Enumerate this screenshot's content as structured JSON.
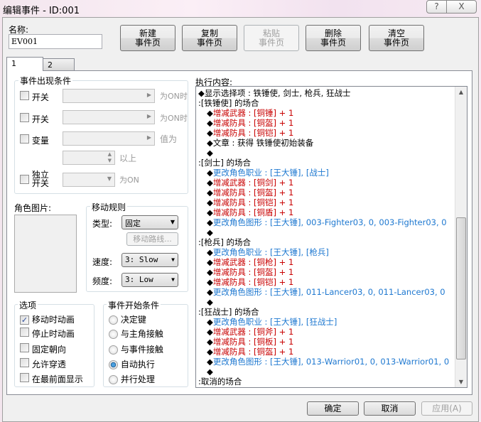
{
  "window": {
    "title": "编辑事件 - ID:001",
    "help": "?",
    "close": "X"
  },
  "name": {
    "label": "名称:",
    "value": "EV001"
  },
  "toolbar": [
    {
      "l1": "新建",
      "l2": "事件页",
      "disabled": false
    },
    {
      "l1": "复制",
      "l2": "事件页",
      "disabled": false
    },
    {
      "l1": "粘贴",
      "l2": "事件页",
      "disabled": true
    },
    {
      "l1": "删除",
      "l2": "事件页",
      "disabled": false
    },
    {
      "l1": "清空",
      "l2": "事件页",
      "disabled": false
    }
  ],
  "tabs": [
    "1",
    "2"
  ],
  "conditions": {
    "title": "事件出现条件",
    "switch1": "开关",
    "switch2": "开关",
    "variable": "变量",
    "self_l1": "独立",
    "self_l2": "开关",
    "on_when1": "为ON时",
    "on_when2": "为ON时",
    "value_is": "值为",
    "above": "以上",
    "is_on": "为ON"
  },
  "graphic": {
    "label": "角色图片:"
  },
  "movement": {
    "title": "移动规则",
    "type_label": "类型:",
    "type_value": "固定",
    "route": "移动路线...",
    "speed_label": "速度:",
    "speed_value": "3: Slow",
    "freq_label": "频度:",
    "freq_value": "3: Low"
  },
  "options": {
    "title": "选项",
    "items": [
      {
        "label": "移动时动画",
        "checked": true
      },
      {
        "label": "停止时动画",
        "checked": false
      },
      {
        "label": "固定朝向",
        "checked": false
      },
      {
        "label": "允许穿透",
        "checked": false
      },
      {
        "label": "在最前面显示",
        "checked": false
      }
    ]
  },
  "trigger": {
    "title": "事件开始条件",
    "items": [
      {
        "label": "决定键",
        "selected": false
      },
      {
        "label": "与主角接触",
        "selected": false
      },
      {
        "label": "与事件接触",
        "selected": false
      },
      {
        "label": "自动执行",
        "selected": true
      },
      {
        "label": "并行处理",
        "selected": false
      }
    ]
  },
  "contents": {
    "label": "执行内容:",
    "lines": [
      {
        "t": "◆显示选择项 : 铁锤使, 剑士, 枪兵, 狂战士",
        "c": "",
        "i": 0
      },
      {
        "t": ":[铁锤使] 的场合",
        "c": "",
        "i": 0
      },
      {
        "t": "增减武器 : [铜锤] + 1",
        "c": "red",
        "i": 1
      },
      {
        "t": "增减防具 : [铜盔] + 1",
        "c": "red",
        "i": 1
      },
      {
        "t": "增减防具 : [铜铠] + 1",
        "c": "red",
        "i": 1
      },
      {
        "t": "文章 : 获得    铁锤使初始装备",
        "c": "",
        "i": 1
      },
      {
        "t": "",
        "c": "",
        "i": 1
      },
      {
        "t": ":[剑士] 的场合",
        "c": "",
        "i": 0
      },
      {
        "t": "更改角色职业 : [王大锤], [战士]",
        "c": "blue",
        "i": 1
      },
      {
        "t": "增减武器 : [铜剑] + 1",
        "c": "red",
        "i": 1
      },
      {
        "t": "增减防具 : [铜盔] + 1",
        "c": "red",
        "i": 1
      },
      {
        "t": "增减防具 : [铜铠] + 1",
        "c": "red",
        "i": 1
      },
      {
        "t": "增减防具 : [铜盾] + 1",
        "c": "red",
        "i": 1
      },
      {
        "t": "更改角色图形 : [王大锤], 003-Fighter03, 0, 003-Fighter03, 0",
        "c": "blue",
        "i": 1
      },
      {
        "t": "",
        "c": "",
        "i": 1
      },
      {
        "t": ":[枪兵] 的场合",
        "c": "",
        "i": 0
      },
      {
        "t": "更改角色职业 : [王大锤], [枪兵]",
        "c": "blue",
        "i": 1
      },
      {
        "t": "增减武器 : [铜枪] + 1",
        "c": "red",
        "i": 1
      },
      {
        "t": "增减防具 : [铜盔] + 1",
        "c": "red",
        "i": 1
      },
      {
        "t": "增减防具 : [铜铠] + 1",
        "c": "red",
        "i": 1
      },
      {
        "t": "更改角色图形 : [王大锤], 011-Lancer03, 0, 011-Lancer03, 0",
        "c": "blue",
        "i": 1
      },
      {
        "t": "",
        "c": "",
        "i": 1
      },
      {
        "t": ":[狂战士] 的场合",
        "c": "",
        "i": 0
      },
      {
        "t": "更改角色职业 : [王大锤], [狂战士]",
        "c": "blue",
        "i": 1
      },
      {
        "t": "增减武器 : [铜斧] + 1",
        "c": "red",
        "i": 1
      },
      {
        "t": "增减防具 : [铜板] + 1",
        "c": "red",
        "i": 1
      },
      {
        "t": "增减防具 : [铜盔] + 1",
        "c": "red",
        "i": 1
      },
      {
        "t": "更改角色图形 : [王大锤], 013-Warrior01, 0, 013-Warrior01, 0",
        "c": "blue",
        "i": 1
      },
      {
        "t": "",
        "c": "",
        "i": 1
      },
      {
        "t": ":取消的场合",
        "c": "",
        "i": 0
      }
    ]
  },
  "footer": {
    "ok": "确定",
    "cancel": "取消",
    "apply": "应用(A)"
  }
}
